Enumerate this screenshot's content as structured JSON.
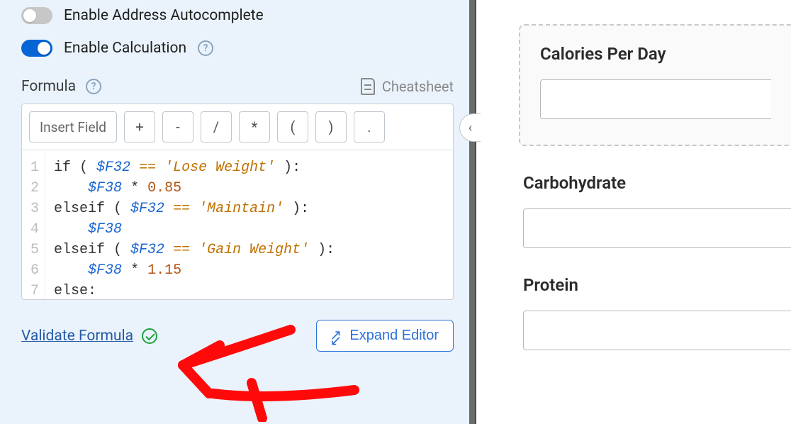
{
  "settings": {
    "autocomplete_label": "Enable Address Autocomplete",
    "calculation_label": "Enable Calculation"
  },
  "formula": {
    "heading": "Formula",
    "cheatsheet_label": "Cheatsheet",
    "insert_field_label": "Insert Field",
    "ops": {
      "plus": "+",
      "minus": "-",
      "divide": "/",
      "multiply": "*",
      "lparen": "(",
      "rparen": ")",
      "dot": "."
    },
    "code_lines": [
      {
        "n": 1,
        "segments": [
          {
            "t": "if ( ",
            "c": "kw"
          },
          {
            "t": "$F32",
            "c": "var"
          },
          {
            "t": " ",
            "c": "kw"
          },
          {
            "t": "==",
            "c": "eq"
          },
          {
            "t": " ",
            "c": "kw"
          },
          {
            "t": "'Lose Weight'",
            "c": "str"
          },
          {
            "t": " ):",
            "c": "kw"
          }
        ]
      },
      {
        "n": 2,
        "segments": [
          {
            "t": "    ",
            "c": "kw"
          },
          {
            "t": "$F38",
            "c": "var"
          },
          {
            "t": " ",
            "c": "kw"
          },
          {
            "t": "*",
            "c": "star"
          },
          {
            "t": " ",
            "c": "kw"
          },
          {
            "t": "0.85",
            "c": "num"
          }
        ]
      },
      {
        "n": 3,
        "segments": [
          {
            "t": "elseif ( ",
            "c": "kw"
          },
          {
            "t": "$F32",
            "c": "var"
          },
          {
            "t": " ",
            "c": "kw"
          },
          {
            "t": "==",
            "c": "eq"
          },
          {
            "t": " ",
            "c": "kw"
          },
          {
            "t": "'Maintain'",
            "c": "str"
          },
          {
            "t": " ):",
            "c": "kw"
          }
        ]
      },
      {
        "n": 4,
        "segments": [
          {
            "t": "    ",
            "c": "kw"
          },
          {
            "t": "$F38",
            "c": "var"
          }
        ]
      },
      {
        "n": 5,
        "segments": [
          {
            "t": "elseif ( ",
            "c": "kw"
          },
          {
            "t": "$F32",
            "c": "var"
          },
          {
            "t": " ",
            "c": "kw"
          },
          {
            "t": "==",
            "c": "eq"
          },
          {
            "t": " ",
            "c": "kw"
          },
          {
            "t": "'Gain Weight'",
            "c": "str"
          },
          {
            "t": " ):",
            "c": "kw"
          }
        ]
      },
      {
        "n": 6,
        "segments": [
          {
            "t": "    ",
            "c": "kw"
          },
          {
            "t": "$F38",
            "c": "var"
          },
          {
            "t": " ",
            "c": "kw"
          },
          {
            "t": "*",
            "c": "star"
          },
          {
            "t": " ",
            "c": "kw"
          },
          {
            "t": "1.15",
            "c": "num"
          }
        ]
      },
      {
        "n": 7,
        "segments": [
          {
            "t": "else:",
            "c": "kw"
          }
        ]
      }
    ],
    "validate_label": "Validate Formula",
    "expand_label": "Expand Editor"
  },
  "preview": {
    "calories_label": "Calories Per Day",
    "carb_label": "Carbohydrate",
    "protein_label": "Protein"
  }
}
